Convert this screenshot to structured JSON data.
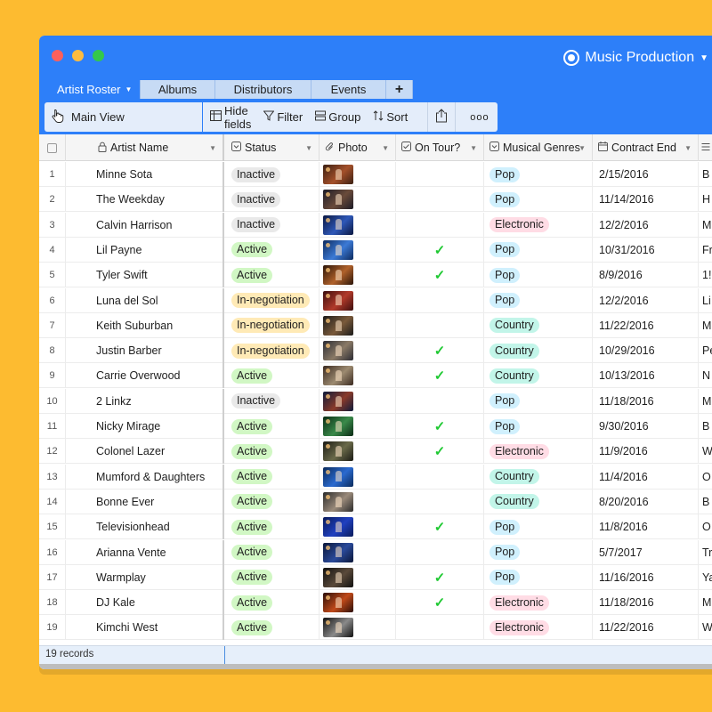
{
  "window": {
    "base_name": "Music Production"
  },
  "tabs": [
    {
      "label": "Artist Roster"
    },
    {
      "label": "Albums"
    },
    {
      "label": "Distributors"
    },
    {
      "label": "Events"
    },
    {
      "label": "+"
    }
  ],
  "toolbar": {
    "view_name": "Main View",
    "hide_fields": "Hide fields",
    "filter": "Filter",
    "group": "Group",
    "sort": "Sort",
    "more": "ooo"
  },
  "columns": {
    "name": "Artist Name",
    "status": "Status",
    "photo": "Photo",
    "tour": "On Tour?",
    "genres": "Musical Genres",
    "contract": "Contract End"
  },
  "colors": {
    "accent": "#2D7FF9",
    "background": "#FDBB30",
    "status_inactive": "#E9E9E9",
    "status_active": "#D1F7C4",
    "status_negotiation": "#FFEAB6",
    "genre_pop": "#D0F0FD",
    "genre_electronic": "#FFDCE5",
    "genre_country": "#C2F5E9",
    "tour_check": "#20C933"
  },
  "rows": [
    {
      "num": "1",
      "name": "Minne Sota",
      "status": "Inactive",
      "tour": "",
      "genre": "Pop",
      "date": "2/15/2016",
      "extra": "B"
    },
    {
      "num": "2",
      "name": "The Weekday",
      "status": "Inactive",
      "tour": "",
      "genre": "Pop",
      "date": "11/14/2016",
      "extra": "H"
    },
    {
      "num": "3",
      "name": "Calvin Harrison",
      "status": "Inactive",
      "tour": "",
      "genre": "Electronic",
      "date": "12/2/2016",
      "extra": "M"
    },
    {
      "num": "4",
      "name": "Lil Payne",
      "status": "Active",
      "tour": "✓",
      "genre": "Pop",
      "date": "10/31/2016",
      "extra": "Fr"
    },
    {
      "num": "5",
      "name": "Tyler Swift",
      "status": "Active",
      "tour": "✓",
      "genre": "Pop",
      "date": "8/9/2016",
      "extra": "1!"
    },
    {
      "num": "6",
      "name": "Luna del Sol",
      "status": "In-negotiation",
      "tour": "",
      "genre": "Pop",
      "date": "12/2/2016",
      "extra": "Li"
    },
    {
      "num": "7",
      "name": "Keith Suburban",
      "status": "In-negotiation",
      "tour": "",
      "genre": "Country",
      "date": "11/22/2016",
      "extra": "M"
    },
    {
      "num": "8",
      "name": "Justin Barber",
      "status": "In-negotiation",
      "tour": "✓",
      "genre": "Country",
      "date": "10/29/2016",
      "extra": "Pe"
    },
    {
      "num": "9",
      "name": "Carrie Overwood",
      "status": "Active",
      "tour": "✓",
      "genre": "Country",
      "date": "10/13/2016",
      "extra": "N"
    },
    {
      "num": "10",
      "name": "2 Linkz",
      "status": "Inactive",
      "tour": "",
      "genre": "Pop",
      "date": "11/18/2016",
      "extra": "M"
    },
    {
      "num": "11",
      "name": "Nicky Mirage",
      "status": "Active",
      "tour": "✓",
      "genre": "Pop",
      "date": "9/30/2016",
      "extra": "B"
    },
    {
      "num": "12",
      "name": "Colonel Lazer",
      "status": "Active",
      "tour": "✓",
      "genre": "Electronic",
      "date": "11/9/2016",
      "extra": "W"
    },
    {
      "num": "13",
      "name": "Mumford & Daughters",
      "status": "Active",
      "tour": "",
      "genre": "Country",
      "date": "11/4/2016",
      "extra": "O"
    },
    {
      "num": "14",
      "name": "Bonne Ever",
      "status": "Active",
      "tour": "",
      "genre": "Country",
      "date": "8/20/2016",
      "extra": "B"
    },
    {
      "num": "15",
      "name": "Televisionhead",
      "status": "Active",
      "tour": "✓",
      "genre": "Pop",
      "date": "11/8/2016",
      "extra": "O"
    },
    {
      "num": "16",
      "name": "Arianna Vente",
      "status": "Active",
      "tour": "",
      "genre": "Pop",
      "date": "5/7/2017",
      "extra": "Tr"
    },
    {
      "num": "17",
      "name": "Warmplay",
      "status": "Active",
      "tour": "✓",
      "genre": "Pop",
      "date": "11/16/2016",
      "extra": "Ya"
    },
    {
      "num": "18",
      "name": "DJ Kale",
      "status": "Active",
      "tour": "✓",
      "genre": "Electronic",
      "date": "11/18/2016",
      "extra": "M"
    },
    {
      "num": "19",
      "name": "Kimchi West",
      "status": "Active",
      "tour": "",
      "genre": "Electronic",
      "date": "11/22/2016",
      "extra": "W"
    }
  ],
  "footer": {
    "records": "19 records"
  }
}
